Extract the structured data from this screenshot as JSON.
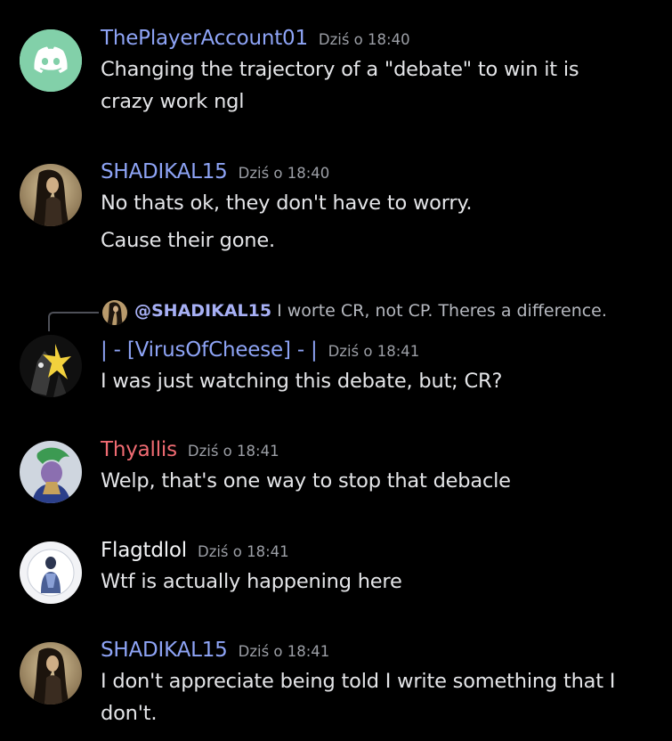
{
  "colors": {
    "background": "#000000",
    "username_blue": "#8ea4f6",
    "username_red": "#f06b72",
    "username_white": "#f2f3f5",
    "timestamp": "#9c9fa6",
    "text": "#e4e5e8",
    "discord_avatar_bg": "#82d0a9"
  },
  "messages": [
    {
      "username": "ThePlayerAccount01",
      "timestamp": "Dziś o 18:40",
      "lines": [
        "Changing the trajectory of a \"debate\" to win it is",
        "crazy work ngl"
      ]
    },
    {
      "username": "SHADIKAL15",
      "timestamp": "Dziś o 18:40",
      "lines": [
        "No thats ok, they don't have to worry.",
        "Cause their gone."
      ]
    },
    {
      "reply": {
        "mention": "@SHADIKAL15",
        "snippet": "I worte CR, not CP. Theres a difference."
      },
      "username": "| - [VirusOfCheese] - |",
      "timestamp": "Dziś o 18:41",
      "lines": [
        "I was just watching this debate, but; CR?"
      ]
    },
    {
      "username": "Thyallis",
      "timestamp": "Dziś o 18:41",
      "lines": [
        "Welp, that's one way to stop that debacle"
      ]
    },
    {
      "username": "Flagtdlol",
      "timestamp": "Dziś o 18:41",
      "lines": [
        "Wtf is actually happening here"
      ]
    },
    {
      "username": "SHADIKAL15",
      "timestamp": "Dziś o 18:41",
      "lines": [
        "I don't appreciate being told I write something that I",
        "don't."
      ]
    }
  ]
}
